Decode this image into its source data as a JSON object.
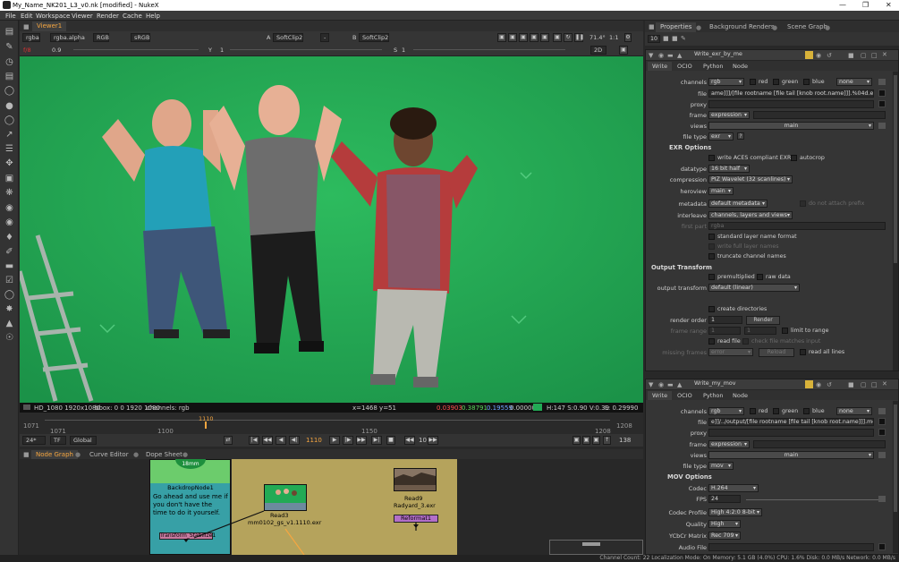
{
  "window": {
    "title": "My_Name_NK201_L3_v0.nk [modified] - NukeX"
  },
  "menu": [
    "File",
    "Edit",
    "Workspace",
    "Viewer",
    "Render",
    "Cache",
    "Help"
  ],
  "viewer": {
    "tab": "Viewer1",
    "channels": "rgba",
    "alpha": "rgba.alpha",
    "display": "RGB",
    "lut": "sRGB",
    "input_a_label": "A",
    "input_a": "SoftClip2",
    "operation": "-",
    "input_b_label": "B",
    "input_b": "SoftClip2",
    "zoom_pct": "71.4°",
    "ratio": "1:1",
    "gain_label": "f/8",
    "gain": "0.9",
    "gamma_label": "Y",
    "gamma": "1",
    "sat_label": "S",
    "sat": "1",
    "view_mode": "2D",
    "info_format": "HD_1080 1920x1080",
    "info_bbox": "bbox: 0 0 1920 1080",
    "info_channels": "channels: rgb",
    "info_xy": "x=1468 y=51",
    "pix_r": "0.03903",
    "pix_g": "0.38791",
    "pix_b": "0.19559",
    "pix_a": "0.00000",
    "pix_hsv": "H:147 S:0.90 V:0.39",
    "pix_l": "L: 0.29990"
  },
  "timeline": {
    "start": "1071",
    "end": "1208",
    "marks": [
      "1071",
      "1100",
      "1150",
      "1208"
    ],
    "current": "1110",
    "fps": "24*",
    "tf": "TF",
    "global": "Global",
    "step": "10",
    "end_frame": "138",
    "start_in": "1071",
    "end_out": "1208"
  },
  "nodegraph": {
    "tabs": [
      "Node Graph",
      "Curve Editor",
      "Dope Sheet"
    ],
    "backdrop_title": "BackdropNode1",
    "backdrop_text": "Go ahead and use me if you don't have the time to do it yourself.",
    "lens_label": "18mm",
    "transform_node": "Transform_Stabilize1",
    "read3_label": "Read3",
    "read3_file": "mm0102_gs_v1.1110.exr",
    "read9_label": "Read9",
    "read9_file": "Radyard_3.exr",
    "reformat_label": "Reformat1"
  },
  "status": "Channel Count: 22  Localization Mode: On  Memory: 5.1 GB (4.0%)  CPU: 1.6%  Disk: 0.0 MB/s  Network: 0.0 MB/s",
  "properties": {
    "tabs": [
      "Properties",
      "Background Renders",
      "Scene Graph"
    ],
    "max_panels": "10"
  },
  "write_exr": {
    "name": "Write_exr_by_me",
    "tabs": [
      "Write",
      "OCIO",
      "Python",
      "Node"
    ],
    "channels_label": "channels",
    "channels": "rgb",
    "red": "red",
    "green": "green",
    "blue": "blue",
    "alpha": "none",
    "file_label": "file",
    "file": "ame]]]/[file rootname [file tail [knob root.name]]].%04d.exr",
    "proxy_label": "proxy",
    "frame_label": "frame",
    "frame": "expression",
    "views_label": "views",
    "views": "main",
    "filetype_label": "file type",
    "filetype": "exr",
    "help": "?",
    "exr_options": "EXR Options",
    "write_aces": "write ACES compliant EXR",
    "autocrop": "autocrop",
    "datatype_label": "datatype",
    "datatype": "16 bit half",
    "compression_label": "compression",
    "compression": "PIZ Wavelet (32 scanlines)",
    "heroview_label": "heroview",
    "heroview": "main",
    "metadata_label": "metadata",
    "metadata": "default metadata",
    "no_prefix": "do not attach prefix",
    "interleave_label": "interleave",
    "interleave": "channels, layers and views",
    "first_part_label": "first part",
    "first_part": "rgba",
    "std_layer": "standard layer name format",
    "full_layer": "write full layer names",
    "truncate": "truncate channel names",
    "output_transform": "Output Transform",
    "premultiplied": "premultiplied",
    "raw_data": "raw data",
    "output_transform_label": "output transform",
    "output_transform_val": "default (linear)",
    "create_dirs": "create directories",
    "render_order_label": "render order",
    "render_order": "1",
    "render_btn": "Render",
    "frame_range_label": "frame range",
    "frame_range_a": "1",
    "frame_range_b": "1",
    "limit_range": "limit to range",
    "read_file": "read file",
    "check_file": "check file matches input",
    "missing_frames_label": "missing frames",
    "missing_frames": "error",
    "reload_btn": "Reload",
    "read_all": "read all lines"
  },
  "write_mov": {
    "name": "Write_my_mov",
    "tabs": [
      "Write",
      "OCIO",
      "Python",
      "Node"
    ],
    "channels_label": "channels",
    "channels": "rgb",
    "red": "red",
    "green": "green",
    "blue": "blue",
    "alpha": "none",
    "file_label": "file",
    "file": "e]]/../output/[file rootname [file tail [knob root.name]]].mov",
    "proxy_label": "proxy",
    "frame_label": "frame",
    "frame": "expression",
    "views_label": "views",
    "views": "main",
    "filetype_label": "file type",
    "filetype": "mov",
    "mov_options": "MOV Options",
    "codec_label": "Codec",
    "codec": "H.264",
    "fps_label": "FPS",
    "fps": "24",
    "profile_label": "Codec Profile",
    "profile": "High 4:2:0 8-bit",
    "quality_label": "Quality",
    "quality": "High",
    "ycbcr_label": "YCbCr Matrix",
    "ycbcr": "Rec 709",
    "audio_label": "Audio File"
  },
  "colors": {
    "accent": "#f6a640",
    "greenscreen": "#22aa55",
    "backdrop": "#b5a35c"
  }
}
